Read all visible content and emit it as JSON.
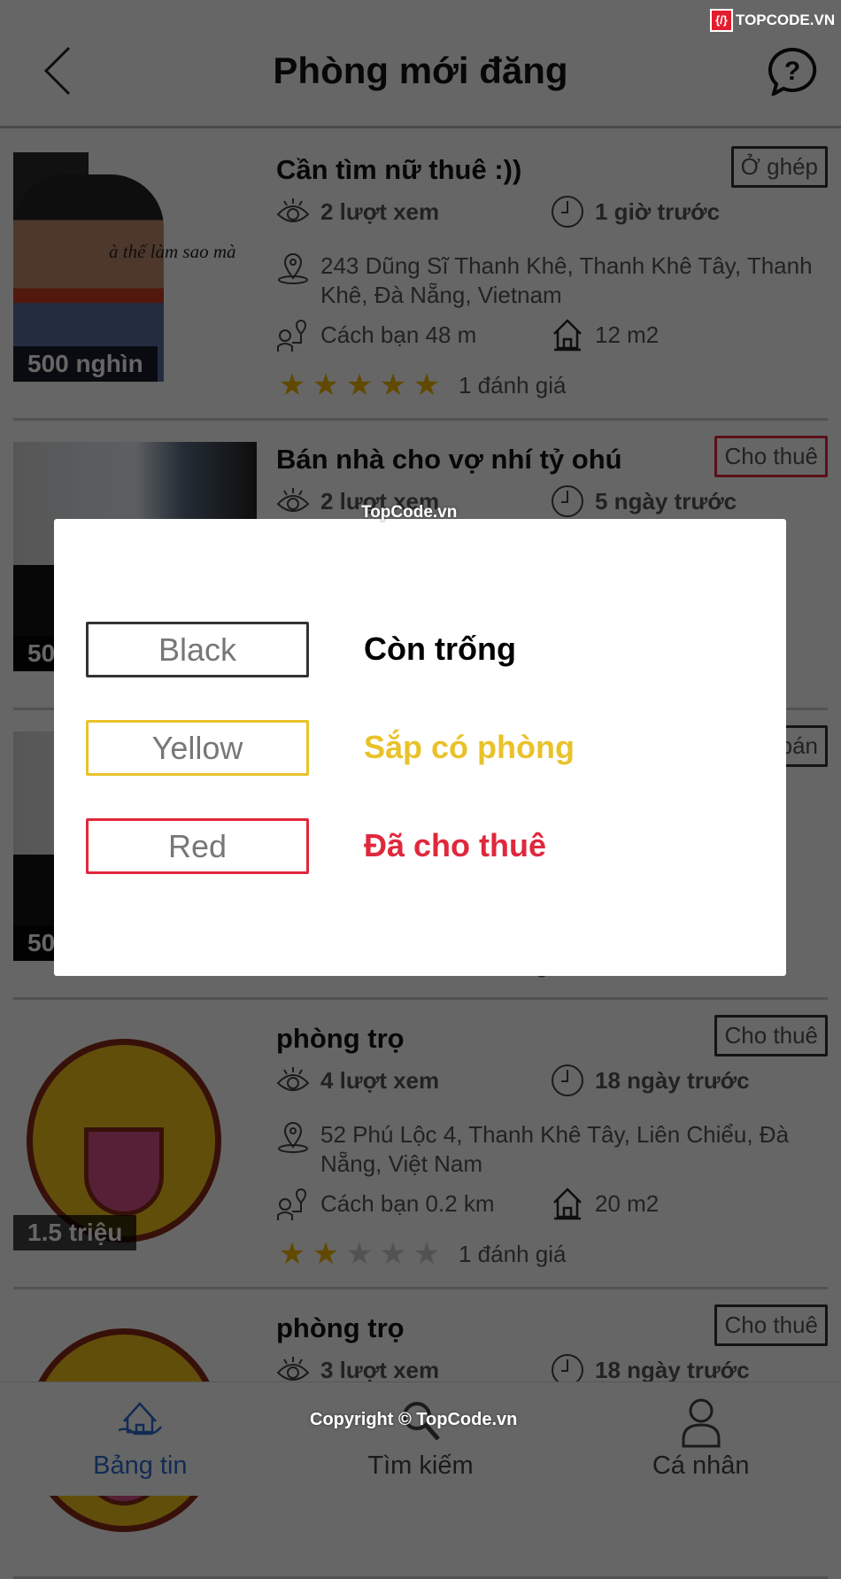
{
  "header": {
    "title": "Phòng mới đăng"
  },
  "listings": [
    {
      "title": "Cần tìm nữ thuê :))",
      "badge": "Ở ghép",
      "badge_color": "#333333",
      "views": "2 lượt xem",
      "time": "1 giờ trước",
      "address": "243 Dũng Sĩ Thanh Khê, Thanh Khê Tây, Thanh Khê, Đà Nẵng, Vietnam",
      "distance": "Cách bạn 48 m",
      "area": "12  m2",
      "rating": 5,
      "reviews": "1 đánh giá",
      "price": "500 nghìn",
      "image": "photo",
      "image_caption": "à thế làm sao mà"
    },
    {
      "title": "Bán nhà cho vợ nhí tỷ ohú",
      "badge": "Cho thuê",
      "badge_color": "#e0283c",
      "views": "2 lượt xem",
      "time": "5 ngày trước",
      "address": "",
      "distance": "",
      "area": "",
      "rating": 0,
      "reviews": "",
      "price": "50",
      "image": "room"
    },
    {
      "title": "",
      "badge": "bán",
      "badge_color": "#333333",
      "views": "",
      "time": "",
      "address": "",
      "distance": "",
      "area": "",
      "rating": 0,
      "reviews": "0 đánh giá",
      "price": "50",
      "image": "room"
    },
    {
      "title": "phòng trọ",
      "badge": "Cho thuê",
      "badge_color": "#333333",
      "views": "4 lượt xem",
      "time": "18 ngày trước",
      "address": "52 Phú Lộc 4, Thanh Khê Tây, Liên Chiểu, Đà Nẵng, Việt Nam",
      "distance": "Cách bạn 0.2 km",
      "area": "20  m2",
      "rating": 2,
      "reviews": "1 đánh giá",
      "price": "1.5 triệu",
      "image": "sticker"
    },
    {
      "title": "phòng trọ",
      "badge": "Cho thuê",
      "badge_color": "#333333",
      "views": "3 lượt xem",
      "time": "18 ngày trước",
      "address": "",
      "distance": "",
      "area": "",
      "rating": 0,
      "reviews": "",
      "price": "",
      "image": "sticker"
    }
  ],
  "dialog": {
    "legend": [
      {
        "box": "Black",
        "label": "Còn trống",
        "color": "#000000",
        "border": "#333333"
      },
      {
        "box": "Yellow",
        "label": "Sắp có phòng",
        "color": "#e9c22a",
        "border": "#e9c22a"
      },
      {
        "box": "Red",
        "label": "Đã cho thuê",
        "color": "#e0283c",
        "border": "#e0283c"
      }
    ]
  },
  "nav": [
    {
      "label": "Bảng tin",
      "icon": "home-hand-icon",
      "active": true
    },
    {
      "label": "Tìm kiếm",
      "icon": "search-icon",
      "active": false
    },
    {
      "label": "Cá nhân",
      "icon": "user-icon",
      "active": false
    }
  ],
  "colors": {
    "active": "#2a6fd1",
    "star": "#f2b600",
    "star_empty": "#cccccc"
  },
  "watermarks": {
    "logo": "TOPCODE.VN",
    "center": "TopCode.vn",
    "footer": "Copyright © TopCode.vn"
  }
}
